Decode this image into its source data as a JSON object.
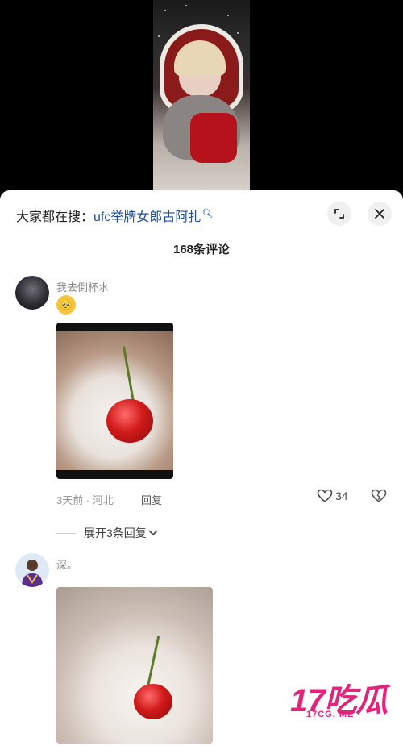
{
  "search_hint": {
    "prefix": "大家都在搜：",
    "keyword": "ufc举牌女郎古阿扎",
    "icon": "search-icon"
  },
  "header_buttons": {
    "expand_icon": "expand-icon",
    "close_icon": "close-icon"
  },
  "comment_count": "168条评论",
  "comments": [
    {
      "username": "我去倒杯水",
      "emoji": "🥺",
      "time_location": "3天前 · 河北",
      "reply_label": "回复",
      "likes": "34",
      "expand_replies": "展开3条回复"
    },
    {
      "username": "深。"
    }
  ],
  "watermark": {
    "brand": "17吃瓜",
    "url": "17CG. ME"
  },
  "colors": {
    "keyword": "#1d4f9a",
    "watermark": "#e2257a"
  }
}
